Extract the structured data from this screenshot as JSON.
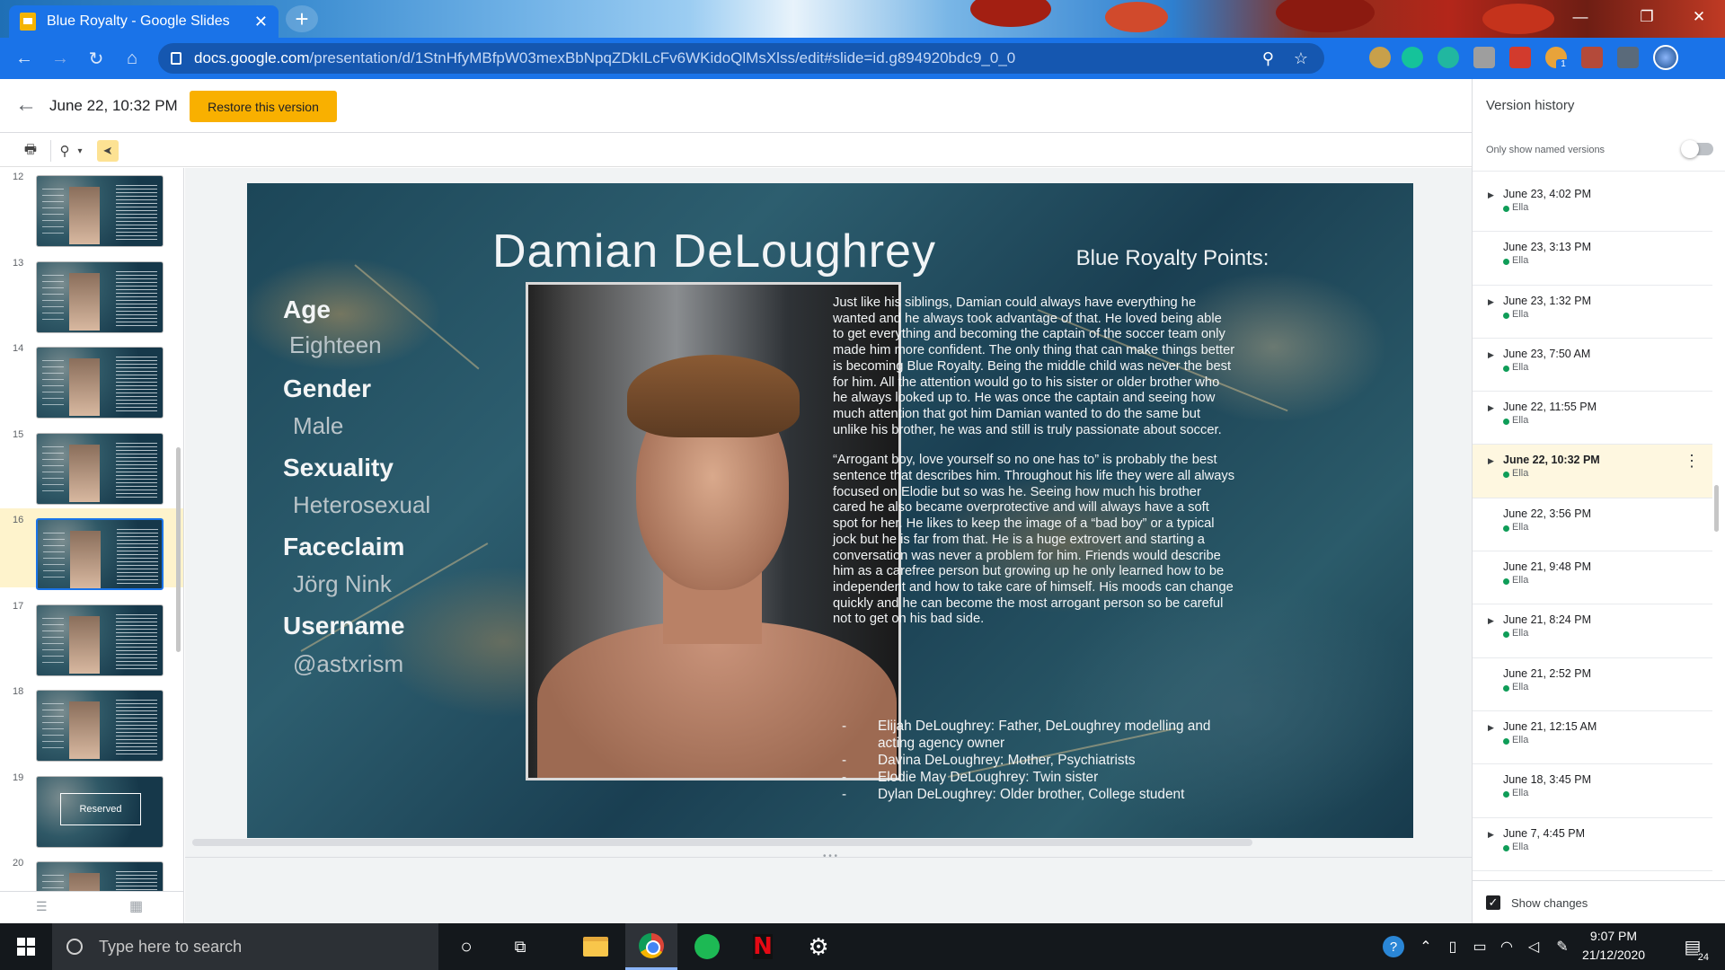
{
  "browser": {
    "tab_title": "Blue Royalty - Google Slides",
    "tab_close": "✕",
    "new_tab": "+",
    "url_host": "docs.google.com",
    "url_path": "/presentation/d/1StnHfyMBfpW03mexBbNpqZDkILcFv6WKidoQlMsXlss/edit#slide=id.g894920bdc9_0_0",
    "window_minimize": "—",
    "window_maximize": "❐",
    "window_close": "✕",
    "extension_badge": "1"
  },
  "version_header": {
    "back_icon": "←",
    "title": "June 22, 10:32 PM",
    "restore_label": "Restore this version"
  },
  "tools": {
    "print_icon": "🖶",
    "zoom_icon": "⚲",
    "zoom_caret": "▾",
    "select_icon": "➤"
  },
  "filmstrip": {
    "slides": [
      {
        "number": "12",
        "kind": "profile"
      },
      {
        "number": "13",
        "kind": "profile"
      },
      {
        "number": "14",
        "kind": "profile"
      },
      {
        "number": "15",
        "kind": "profile"
      },
      {
        "number": "16",
        "kind": "profile",
        "selected": true
      },
      {
        "number": "17",
        "kind": "profile"
      },
      {
        "number": "18",
        "kind": "profile"
      },
      {
        "number": "19",
        "kind": "reserved",
        "label": "Reserved"
      },
      {
        "number": "20",
        "kind": "profile"
      }
    ],
    "footer_list_icon": "☰",
    "footer_grid_icon": "▦"
  },
  "slide": {
    "title": "Damian DeLoughrey",
    "points_heading": "Blue Royalty Points:",
    "fields": [
      {
        "label": "Age",
        "value": "Eighteen"
      },
      {
        "label": "Gender",
        "value": "Male"
      },
      {
        "label": "Sexuality",
        "value": "Heterosexual"
      },
      {
        "label": "Faceclaim",
        "value": "Jörg Nink"
      },
      {
        "label": "Username",
        "value": "@astxrism"
      }
    ],
    "bio_paragraph_1": "Just like his siblings, Damian could always have everything he wanted and he always took advantage of that. He loved being able to get everything and becoming the captain of the soccer team only made him more confident. The only thing that can make things better is becoming Blue Royalty. Being the middle child was never the best for him. All the attention would go to his sister or older brother who he always looked up to. He was once the captain and seeing how much attention that got him Damian wanted to do the same but unlike his brother, he was and still is truly passionate about soccer.",
    "bio_paragraph_2": "“Arrogant boy, love yourself so no one has to” is probably the best sentence that describes him. Throughout his life they were all always focused on Elodie but so was he. Seeing how much his brother cared he also became overprotective and will always have a soft spot for her. He likes to keep the image of a “bad boy” or a typical jock but he is far from that. He is a huge extrovert and starting a conversation was never a problem for him. Friends would describe him as a carefree person but growing up he only learned how to be independent and how to take care of himself. His moods can change quickly and he can become the most arrogant person so be careful not to get on his bad side.",
    "family": [
      "Elijah DeLoughrey: Father, DeLoughrey modelling and acting agency owner",
      "Davina DeLoughrey: Mother, Psychiatrists",
      "Elodie May DeLoughrey: Twin sister",
      "Dylan DeLoughrey: Older brother, College student"
    ],
    "bullet": "-"
  },
  "version_history": {
    "title": "Version history",
    "only_named_label": "Only show named versions",
    "show_changes_label": "Show changes",
    "versions": [
      {
        "date": "June 23, 4:02 PM",
        "author": "Ella",
        "expandable": true
      },
      {
        "date": "June 23, 3:13 PM",
        "author": "Ella",
        "expandable": false
      },
      {
        "date": "June 23, 1:32 PM",
        "author": "Ella",
        "expandable": true
      },
      {
        "date": "June 23, 7:50 AM",
        "author": "Ella",
        "expandable": true
      },
      {
        "date": "June 22, 11:55 PM",
        "author": "Ella",
        "expandable": true
      },
      {
        "date": "June 22, 10:32 PM",
        "author": "Ella",
        "expandable": true,
        "selected": true
      },
      {
        "date": "June 22, 3:56 PM",
        "author": "Ella",
        "expandable": false
      },
      {
        "date": "June 21, 9:48 PM",
        "author": "Ella",
        "expandable": false
      },
      {
        "date": "June 21, 8:24 PM",
        "author": "Ella",
        "expandable": true
      },
      {
        "date": "June 21, 2:52 PM",
        "author": "Ella",
        "expandable": false
      },
      {
        "date": "June 21, 12:15 AM",
        "author": "Ella",
        "expandable": true
      },
      {
        "date": "June 18, 3:45 PM",
        "author": "Ella",
        "expandable": false
      },
      {
        "date": "June 7, 4:45 PM",
        "author": "Ella",
        "expandable": true
      }
    ],
    "author_dot_color": "#0f9d58"
  },
  "taskbar": {
    "search_placeholder": "Type here to search",
    "time": "9:07 PM",
    "date": "21/12/2020",
    "notification_count": "24"
  },
  "colors": {
    "chrome_blue": "#1a73e8",
    "restore_yellow": "#f9b000",
    "selected_row": "#fef7e0"
  }
}
